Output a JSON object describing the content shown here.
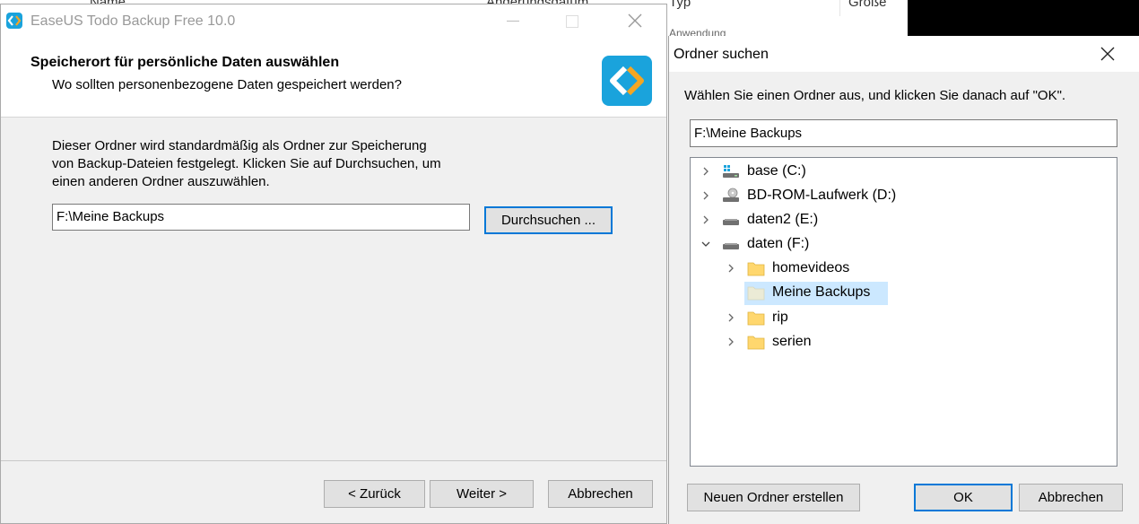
{
  "background": {
    "columns": [
      "Name",
      "Änderungsdatum",
      "Typ",
      "Größe"
    ],
    "sub_text": "Anwendung"
  },
  "installer": {
    "title": "EaseUS Todo Backup Free 10.0",
    "header_title": "Speicherort für persönliche Daten auswählen",
    "header_subtitle": "Wo sollten personenbezogene Daten gespeichert werden?",
    "description_lines": [
      "Dieser Ordner wird standardmäßig als Ordner zur Speicherung",
      "von Backup-Dateien festgelegt. Klicken Sie auf Durchsuchen, um",
      "einen anderen Ordner auszuwählen."
    ],
    "path_value": "F:\\Meine Backups",
    "browse_label": "Durchsuchen ...",
    "back_label": "< Zurück",
    "next_label": "Weiter >",
    "cancel_label": "Abbrechen",
    "brand_color": "#1aa3dc",
    "accent_color": "#f5a623"
  },
  "dialog": {
    "title": "Ordner suchen",
    "instruction": "Wählen Sie einen Ordner aus, und klicken Sie danach auf \"OK\".",
    "path_value": "F:\\Meine Backups",
    "tree": [
      {
        "label": "base (C:)",
        "icon": "drive-windows-icon",
        "level": 0,
        "state": "collapsed"
      },
      {
        "label": "BD-ROM-Laufwerk (D:)",
        "icon": "optical-drive-icon",
        "level": 0,
        "state": "collapsed"
      },
      {
        "label": "daten2 (E:)",
        "icon": "drive-icon",
        "level": 0,
        "state": "collapsed"
      },
      {
        "label": "daten (F:)",
        "icon": "drive-icon",
        "level": 0,
        "state": "expanded"
      },
      {
        "label": "homevideos",
        "icon": "folder-icon",
        "level": 1,
        "state": "collapsed"
      },
      {
        "label": "Meine Backups",
        "icon": "folder-icon",
        "level": 1,
        "state": "none",
        "selected": true
      },
      {
        "label": "rip",
        "icon": "folder-icon",
        "level": 1,
        "state": "collapsed"
      },
      {
        "label": "serien",
        "icon": "folder-icon",
        "level": 1,
        "state": "collapsed"
      }
    ],
    "new_folder_label": "Neuen Ordner erstellen",
    "ok_label": "OK",
    "cancel_label": "Abbrechen",
    "selection_color": "#cce8ff",
    "focus_color": "#0078d7"
  }
}
